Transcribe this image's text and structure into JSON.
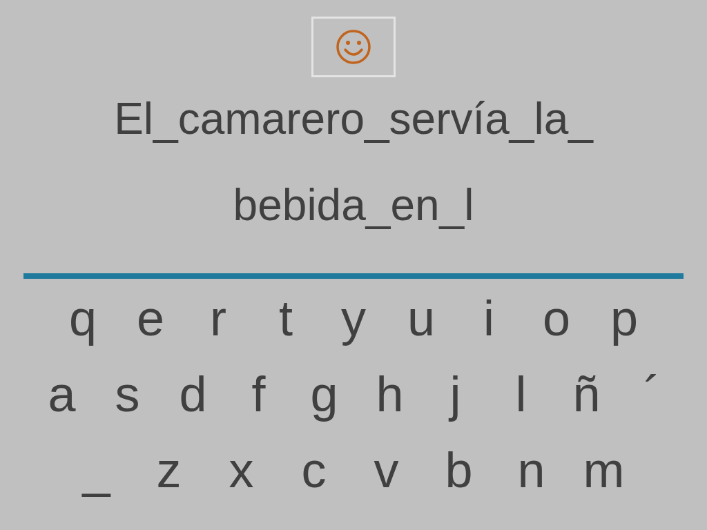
{
  "sentence": {
    "lines": [
      "El_camarero_servía_la_",
      "bebida_en_l"
    ]
  },
  "keyboard": {
    "rows": [
      [
        "q",
        "e",
        "r",
        "t",
        "y",
        "u",
        "i",
        "o",
        "p"
      ],
      [
        "a",
        "s",
        "d",
        "f",
        "g",
        "h",
        "j",
        "l",
        "ñ",
        "´"
      ],
      [
        "_",
        "z",
        "x",
        "c",
        "v",
        "b",
        "n",
        "m"
      ]
    ]
  }
}
